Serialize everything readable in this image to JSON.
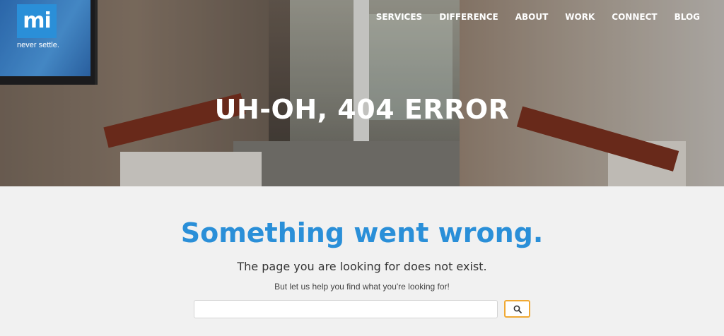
{
  "brand": {
    "logo_text": "mi",
    "tagline": "never settle."
  },
  "nav": {
    "items": [
      {
        "label": "SERVICES"
      },
      {
        "label": "DIFFERENCE"
      },
      {
        "label": "ABOUT"
      },
      {
        "label": "WORK"
      },
      {
        "label": "CONNECT"
      },
      {
        "label": "BLOG"
      }
    ]
  },
  "hero": {
    "title": "UH-OH, 404 ERROR"
  },
  "content": {
    "headline": "Something went wrong.",
    "subhead": "The page you are looking for does not exist.",
    "helper": "But let us help you find what you're looking for!"
  },
  "search": {
    "value": "",
    "button_icon": "search-icon"
  },
  "colors": {
    "brand_blue": "#2a8fd8",
    "search_border": "#f0a934"
  }
}
